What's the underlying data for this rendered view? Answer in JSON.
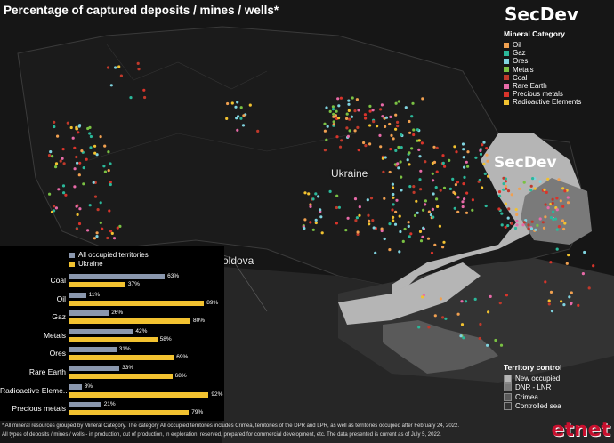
{
  "title": "Percentage of captured deposits / mines / wells*",
  "brand": "SecDev",
  "places": {
    "ukraine": "Ukraine",
    "moldova": "Moldova"
  },
  "legend": {
    "title": "Mineral Category",
    "items": [
      {
        "label": "Oil",
        "color": "#f0a050"
      },
      {
        "label": "Gaz",
        "color": "#2bb89a"
      },
      {
        "label": "Ores",
        "color": "#7fd3df"
      },
      {
        "label": "Metals",
        "color": "#7ac143"
      },
      {
        "label": "Coal",
        "color": "#c0392b"
      },
      {
        "label": "Rare Earth",
        "color": "#e86aa8"
      },
      {
        "label": "Precious metals",
        "color": "#d9342b"
      },
      {
        "label": "Radioactive Elements",
        "color": "#f2c230"
      }
    ]
  },
  "territory": {
    "title": "Territory control",
    "items": [
      {
        "label": "New occupied",
        "color": "#b5b5b5"
      },
      {
        "label": "DNR - LNR",
        "color": "#7a7a7a"
      },
      {
        "label": "Crimea",
        "color": "#5a5a5a"
      },
      {
        "label": "Controlled sea",
        "color": "#333333"
      }
    ]
  },
  "chart_data": {
    "type": "bar",
    "series": [
      {
        "name": "All occupied territories",
        "color": "#8a97ad",
        "values": [
          63,
          11,
          26,
          42,
          31,
          33,
          8,
          21
        ]
      },
      {
        "name": "Ukraine",
        "color": "#f2c230",
        "values": [
          37,
          89,
          80,
          58,
          69,
          68,
          92,
          79
        ]
      }
    ],
    "categories": [
      "Coal",
      "Oil",
      "Gaz",
      "Metals",
      "Ores",
      "Rare Earth",
      "Radioactive Eleme..",
      "Precious metals"
    ],
    "value_suffix": "%",
    "xlim": [
      0,
      100
    ]
  },
  "footnotes": [
    "* All mineral resources grouped by Mineral Category. The category All occupied territories includes Crimea, territories of the DPR and LPR, as well as territories occupied after February 24, 2022.",
    "All types of deposits / mines / wells - in production, out of production, in exploration, reserved, prepared for commercial development, etc. The data presented is current as of July 5, 2022."
  ],
  "watermark": "etnet"
}
